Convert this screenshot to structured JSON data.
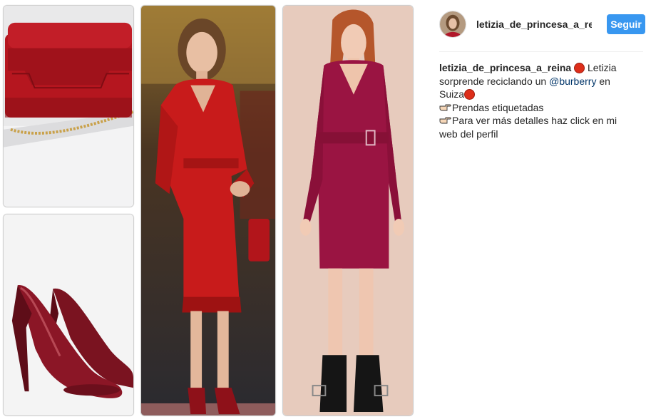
{
  "post": {
    "username": "letizia_de_princesa_a_reina",
    "follow_label": "Seguir",
    "caption": {
      "user": "letizia_de_princesa_a_reina",
      "text_1": "Letizia sorprende reciclando un",
      "mention": "@burberry",
      "text_2": "en Suiza",
      "line_2": "Prendas etiquetadas",
      "line_3": "Para ver más detalles haz click en mi web del perfil"
    }
  },
  "icons": {
    "red_circle": "red-circle-emoji",
    "pointing_hand": "backhand-index-pointing-right-emoji"
  },
  "colors": {
    "follow_button": "#3897f0",
    "mention": "#003569",
    "red_circle": "#dd2e1a"
  }
}
